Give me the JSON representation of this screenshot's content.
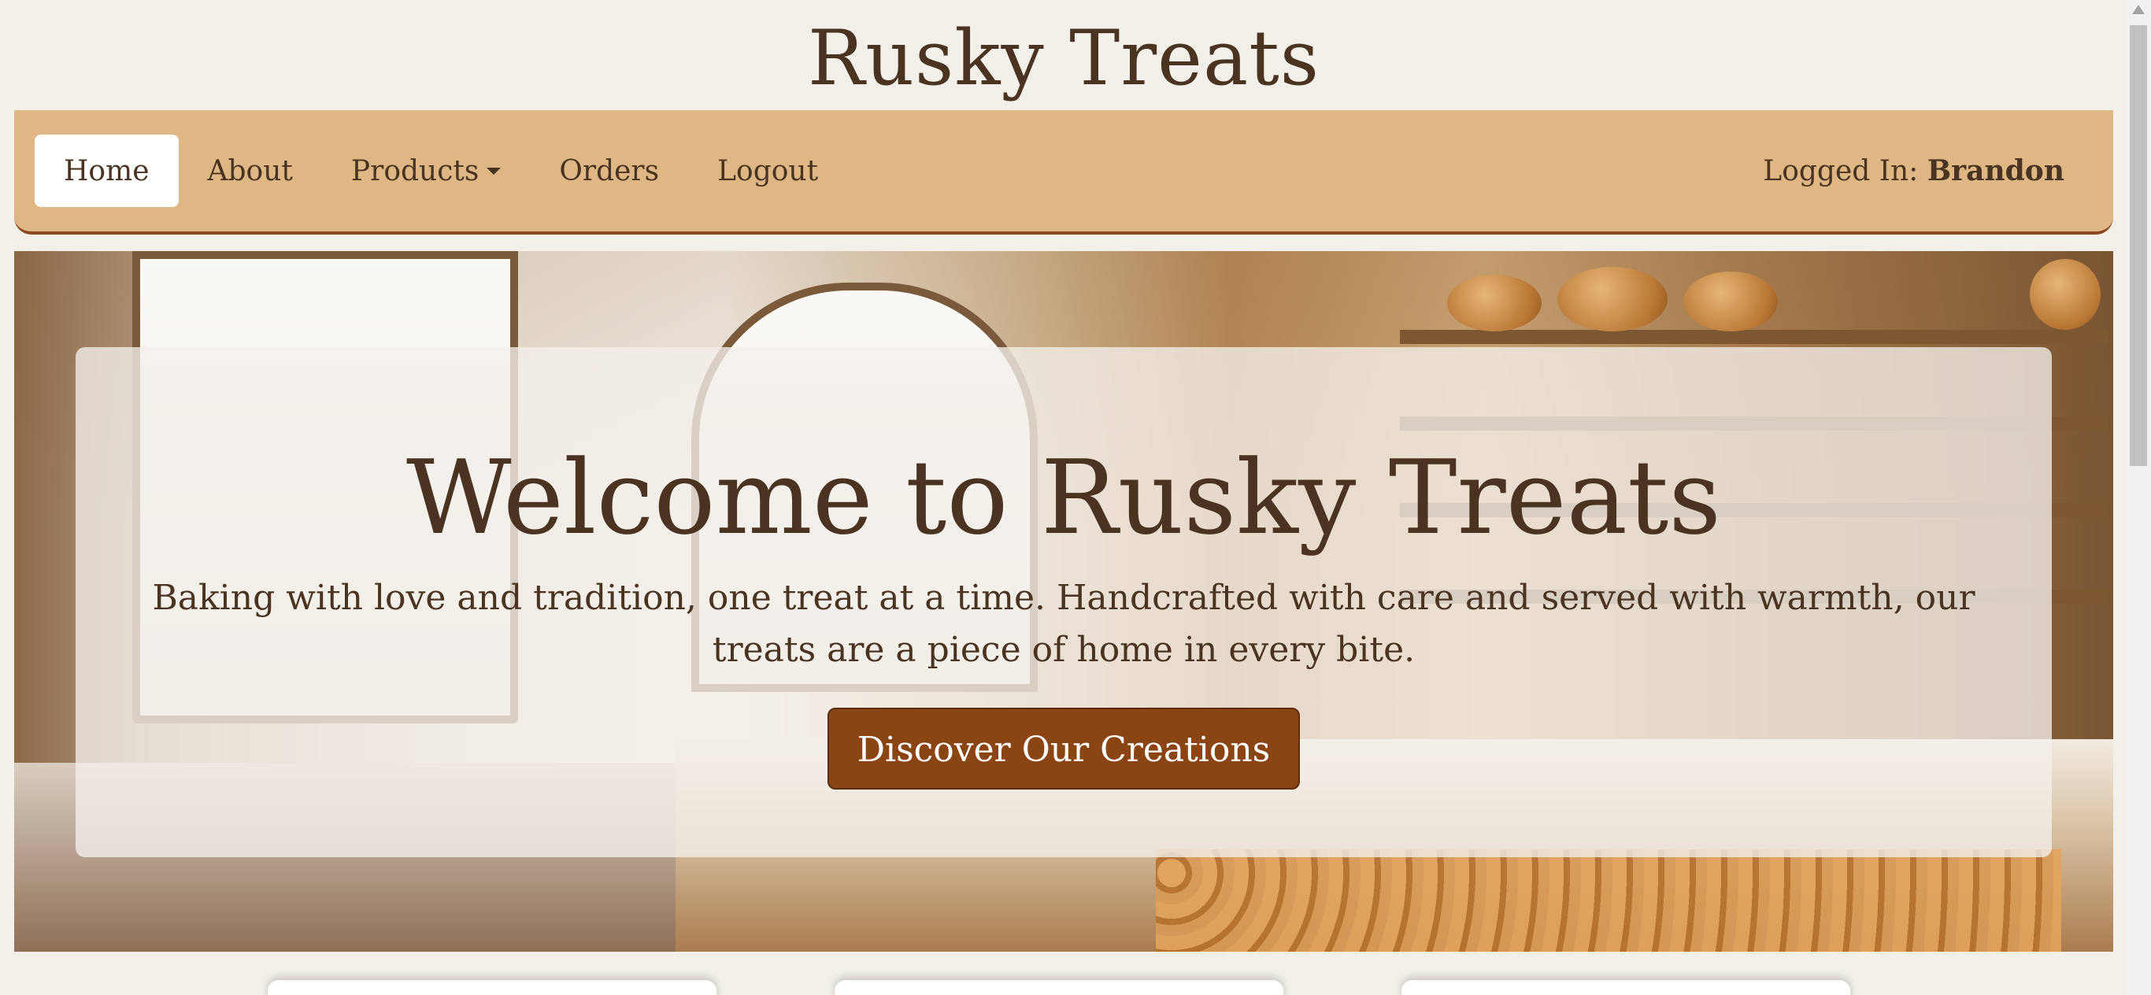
{
  "header": {
    "brand": "Rusky Treats"
  },
  "nav": {
    "items": [
      {
        "label": "Home",
        "active": true
      },
      {
        "label": "About"
      },
      {
        "label": "Products",
        "has_dropdown": true
      },
      {
        "label": "Orders"
      },
      {
        "label": "Logout"
      }
    ],
    "user_prefix": "Logged In: ",
    "user_name": "Brandon"
  },
  "hero": {
    "title": "Welcome to Rusky Treats",
    "text": "Baking with love and tradition, one treat at a time. Handcrafted with care and served with warmth, our treats are a piece of home in every bite.",
    "button_label": "Discover Our Creations"
  },
  "colors": {
    "background": "#f3f0ea",
    "navbar": "#dfb785",
    "text": "#4a3320",
    "button": "#8b4513"
  },
  "icons": {
    "dropdown": "caret-down-icon"
  }
}
